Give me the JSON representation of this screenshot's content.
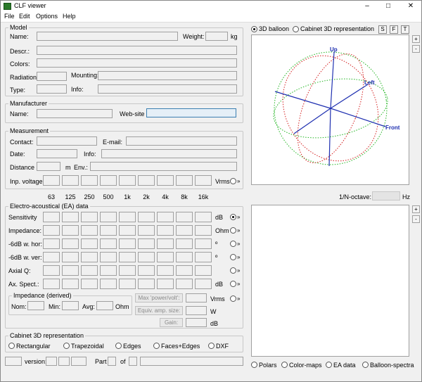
{
  "window": {
    "title": "CLF viewer",
    "minimize": "–",
    "maximize": "□",
    "close": "✕"
  },
  "menu": [
    "File",
    "Edit",
    "Options",
    "Help"
  ],
  "model": {
    "title": "Model",
    "name_label": "Name:",
    "weight_label": "Weight:",
    "weight_unit": "kg",
    "descr_label": "Descr.:",
    "colors_label": "Colors:",
    "radiation_label": "Radiation",
    "mounting_label": "Mounting:",
    "type_label": "Type:",
    "info_label": "Info:"
  },
  "manufacturer": {
    "title": "Manufacturer",
    "name_label": "Name:",
    "website_label": "Web-site"
  },
  "measurement": {
    "title": "Measurement",
    "contact_label": "Contact:",
    "email_label": "E-mail:",
    "date_label": "Date:",
    "info_label": "Info:",
    "distance_label": "Distance",
    "distance_unit": "m",
    "env_label": "Env.:",
    "input_voltage_label": "Inp. voltage:",
    "input_voltage_unit": "Vrms"
  },
  "frequencies": [
    "63",
    "125",
    "250",
    "500",
    "1k",
    "2k",
    "4k",
    "8k",
    "16k"
  ],
  "ea": {
    "title": "Electro-acoustical (EA) data",
    "rows": [
      {
        "label": "Sensitivity",
        "unit": "dB",
        "selected": true
      },
      {
        "label": "Impedance:",
        "unit": "Ohm",
        "selected": false
      },
      {
        "label": "-6dB w. hor:",
        "unit": "º",
        "selected": false
      },
      {
        "label": "-6dB w. ver:",
        "unit": "º",
        "selected": false
      },
      {
        "label": "Axial Q:",
        "unit": "",
        "selected": false
      },
      {
        "label": "Ax. Spect.:",
        "unit": "dB",
        "selected": false
      }
    ],
    "arrow": "»"
  },
  "impedance_derived": {
    "title": "Impedance (derived)",
    "nom_label": "Nom:",
    "min_label": "Min:",
    "avg_label": "Avg:",
    "unit": "Ohm",
    "max_power_btn": "Max 'power/volt':",
    "equiv_amp_btn": "Equiv. amp. size:",
    "gain_btn": "Gain:",
    "vrms_unit": "Vrms",
    "w_unit": "W",
    "db_unit": "dB"
  },
  "cabinet": {
    "title": "Cabinet 3D representation",
    "options": [
      "Rectangular",
      "Trapezoidal",
      "Edges",
      "Faces+Edges",
      "DXF"
    ]
  },
  "status": {
    "version_label": "version:",
    "part_label": "Part",
    "of_label": "of"
  },
  "view": {
    "balloon_label": "3D balloon",
    "cabinet_label": "Cabinet 3D representation",
    "buttons": [
      "S",
      "F",
      "T"
    ],
    "plus": "+",
    "minus": "-",
    "axis_up": "Up",
    "axis_left": "Left",
    "axis_front": "Front"
  },
  "octave": {
    "label": "1/N-octave:",
    "unit": "Hz"
  },
  "bottom_radios": [
    "Polars",
    "Color-maps",
    "EA data",
    "Balloon-spectra"
  ],
  "colors": {
    "green": "#22b522",
    "red": "#d42020",
    "blue": "#1e2fb0",
    "highlight": "#3c7fb1"
  }
}
